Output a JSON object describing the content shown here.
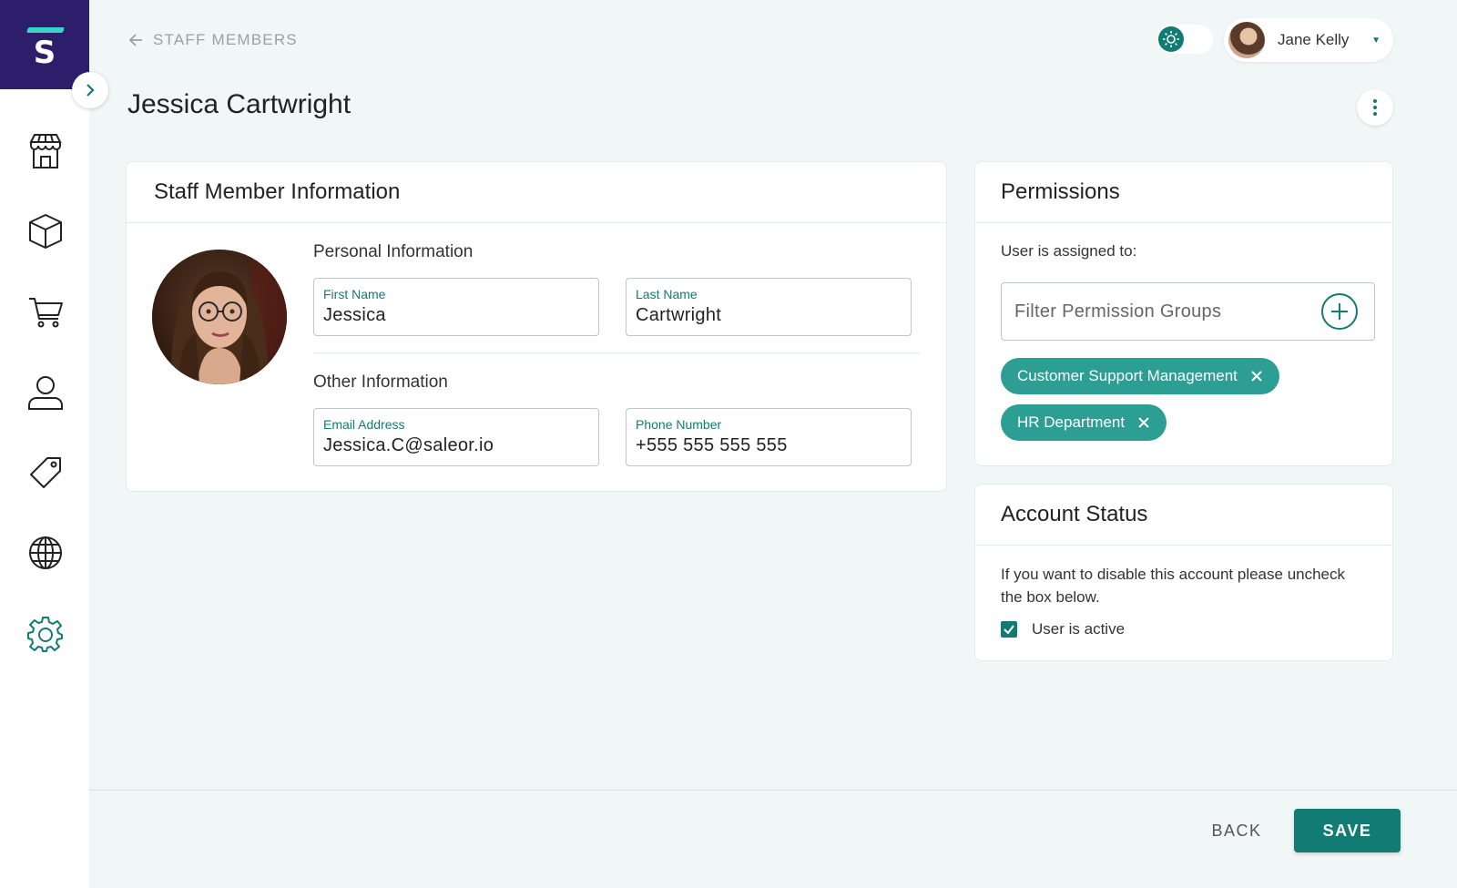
{
  "brand": {
    "logo_letter": "S",
    "colors": {
      "primary": "#127b74",
      "chip": "#2d9e93",
      "logo_bg": "#2c1e6b",
      "logo_accent": "#3bd3c5"
    }
  },
  "sidebar": {
    "items": [
      {
        "icon": "store-icon"
      },
      {
        "icon": "box-icon"
      },
      {
        "icon": "cart-icon"
      },
      {
        "icon": "user-icon"
      },
      {
        "icon": "tag-icon"
      },
      {
        "icon": "globe-icon"
      },
      {
        "icon": "gear-icon",
        "active": true
      }
    ]
  },
  "header": {
    "breadcrumb": "STAFF MEMBERS",
    "user": {
      "name": "Jane Kelly"
    }
  },
  "page": {
    "title": "Jessica Cartwright"
  },
  "staff_info": {
    "title": "Staff Member Information",
    "personal_label": "Personal Information",
    "other_label": "Other Information",
    "first_name": {
      "label": "First Name",
      "value": "Jessica"
    },
    "last_name": {
      "label": "Last Name",
      "value": "Cartwright"
    },
    "email": {
      "label": "Email Address",
      "value": "Jessica.C@saleor.io"
    },
    "phone": {
      "label": "Phone Number",
      "value": "+555 555 555 555"
    }
  },
  "permissions": {
    "title": "Permissions",
    "assigned_label": "User is assigned to:",
    "filter_placeholder": "Filter Permission Groups",
    "groups": [
      "Customer Support Management",
      "HR Department"
    ]
  },
  "account_status": {
    "title": "Account Status",
    "description": "If you want to disable this account please uncheck the box below.",
    "checkbox_label": "User is active",
    "active": true
  },
  "footer": {
    "back_label": "BACK",
    "save_label": "SAVE"
  }
}
